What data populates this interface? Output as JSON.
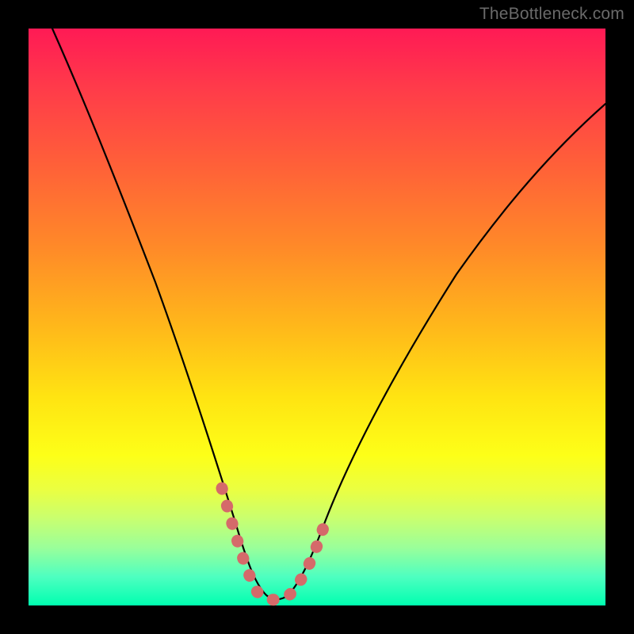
{
  "watermark": "TheBottleneck.com",
  "chart_data": {
    "type": "line",
    "title": "",
    "xlabel": "",
    "ylabel": "",
    "xlim": [
      0,
      100
    ],
    "ylim": [
      0,
      100
    ],
    "grid": false,
    "legend": false,
    "series": [
      {
        "name": "main-curve",
        "color": "#000000",
        "x": [
          4,
          10,
          16,
          22,
          27,
          31,
          35,
          38,
          41,
          44,
          48,
          52,
          58,
          64,
          72,
          80,
          88,
          96,
          100
        ],
        "y": [
          100,
          84,
          68,
          52,
          38,
          27,
          18,
          11,
          6,
          2,
          2,
          6,
          14,
          24,
          38,
          50,
          60,
          68,
          72
        ]
      },
      {
        "name": "highlight-band",
        "color": "#d56a6a",
        "x": [
          31,
          35,
          38,
          41,
          44,
          46,
          48,
          50,
          52
        ],
        "y": [
          18,
          11,
          6,
          2,
          2,
          4,
          6,
          10,
          14
        ]
      }
    ],
    "gradient_stops": [
      {
        "pos": 0,
        "color": "#ff1a55"
      },
      {
        "pos": 24,
        "color": "#ff6138"
      },
      {
        "pos": 52,
        "color": "#ffb91a"
      },
      {
        "pos": 74,
        "color": "#fdff18"
      },
      {
        "pos": 90,
        "color": "#9aff9a"
      },
      {
        "pos": 100,
        "color": "#00ffb0"
      }
    ]
  }
}
